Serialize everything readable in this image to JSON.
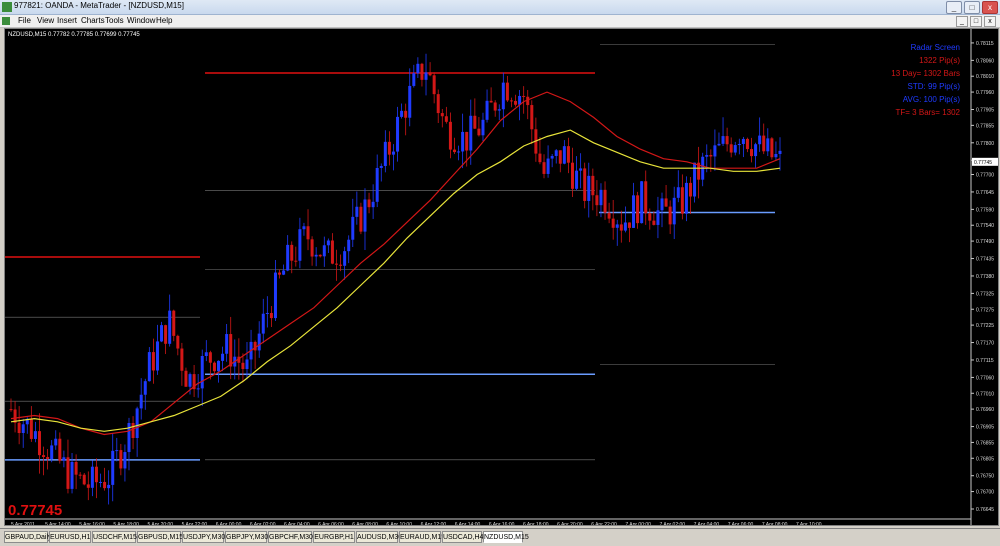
{
  "window": {
    "title": "977821: OANDA - MetaTrader - [NZDUSD,M15]",
    "buttons": [
      "_",
      "□",
      "x"
    ]
  },
  "menu": {
    "items": [
      "File",
      "View",
      "Insert",
      "Charts",
      "Tools",
      "Window",
      "Help"
    ],
    "mdi_buttons": [
      "_",
      "□",
      "x"
    ]
  },
  "chart": {
    "header": "NZDUSD,M15  0.77782 0.77785 0.77699 0.77745",
    "price_label": "0.77745",
    "current_price_box": "0.77745",
    "info": {
      "title": "Radar Screen",
      "lines": [
        "1322 Pip(s)",
        "13 Day= 1302 Bars",
        "STD: 99 Pip(s)",
        "AVG: 100 Pip(s)",
        "TF= 3 Bars= 1302"
      ]
    },
    "colors": {
      "bull": "#1f3bff",
      "bear": "#d31717",
      "ma_fast": "#d31717",
      "ma_slow": "#e8e43a",
      "level_red": "#e01010",
      "level_blue": "#6a9cff"
    }
  },
  "chart_data": {
    "type": "line",
    "symbol": "NZDUSD",
    "timeframe": "M15",
    "y_ticks": [
      0.78115,
      0.7806,
      0.7801,
      0.7796,
      0.77905,
      0.77855,
      0.778,
      0.77745,
      0.777,
      0.77645,
      0.7759,
      0.7754,
      0.7749,
      0.77435,
      0.7738,
      0.77325,
      0.77275,
      0.77225,
      0.7717,
      0.77115,
      0.7706,
      0.7701,
      0.7696,
      0.76905,
      0.76855,
      0.76805,
      0.7675,
      0.767,
      0.76645
    ],
    "ylim": [
      0.76645,
      0.7814
    ],
    "x_ticks": [
      "5 Apr 2011",
      "5 Apr 14:00",
      "5 Apr 16:00",
      "5 Apr 18:00",
      "5 Apr 20:00",
      "5 Apr 22:00",
      "6 Apr 00:00",
      "6 Apr 02:00",
      "6 Apr 04:00",
      "6 Apr 06:00",
      "6 Apr 08:00",
      "6 Apr 10:00",
      "6 Apr 12:00",
      "6 Apr 14:00",
      "6 Apr 16:00",
      "6 Apr 18:00",
      "6 Apr 20:00",
      "6 Apr 22:00",
      "7 Apr 00:00",
      "7 Apr 02:00",
      "7 Apr 04:00",
      "7 Apr 06:00",
      "7 Apr 08:00",
      "7 Apr 10:00"
    ],
    "close_path": [
      0.7696,
      0.769,
      0.7683,
      0.7675,
      0.7672,
      0.7675,
      0.7689,
      0.7709,
      0.7724,
      0.7705,
      0.7712,
      0.7715,
      0.7708,
      0.7727,
      0.7742,
      0.7751,
      0.7744,
      0.7748,
      0.776,
      0.7775,
      0.7792,
      0.7805,
      0.7785,
      0.7781,
      0.7786,
      0.7799,
      0.7795,
      0.777,
      0.7777,
      0.7765,
      0.7764,
      0.7755,
      0.7762,
      0.7757,
      0.7761,
      0.7772,
      0.7778,
      0.7784,
      0.7778,
      0.7774
    ],
    "series": [
      {
        "name": "",
        "values": [
          0.7693,
          0.7694,
          0.7693,
          0.769,
          0.7688,
          0.7689,
          0.7692,
          0.7698,
          0.7704,
          0.7708,
          0.7713,
          0.7718,
          0.7723,
          0.7728,
          0.7735,
          0.7742,
          0.7748,
          0.7755,
          0.7762,
          0.777,
          0.7778,
          0.7787,
          0.7793,
          0.7796,
          0.7793,
          0.7788,
          0.7782,
          0.7778,
          0.7775,
          0.7774,
          0.7772,
          0.7772,
          0.7772,
          0.7775
        ]
      },
      {
        "name": "",
        "values": [
          0.7692,
          0.7693,
          0.7692,
          0.769,
          0.7689,
          0.769,
          0.7692,
          0.7694,
          0.7697,
          0.77,
          0.7705,
          0.7711,
          0.7716,
          0.7722,
          0.7728,
          0.7735,
          0.7742,
          0.775,
          0.7757,
          0.7764,
          0.777,
          0.7774,
          0.7779,
          0.7782,
          0.7784,
          0.778,
          0.7777,
          0.7774,
          0.7772,
          0.7772,
          0.7772,
          0.7771,
          0.7771,
          0.7772
        ]
      }
    ],
    "levels": [
      {
        "price": 0.7802,
        "color": "red"
      },
      {
        "price": 0.7744,
        "color": "red"
      },
      {
        "price": 0.7758,
        "color": "blue"
      },
      {
        "price": 0.7707,
        "color": "blue"
      },
      {
        "price": 0.768,
        "color": "blue"
      }
    ]
  },
  "tabs": [
    "GBPAUD,Daily",
    "EURUSD,H1",
    "USDCHF,M15",
    "GBPUSD,M15",
    "USDJPY,M30",
    "GBPJPY,M30",
    "GBPCHF,M30",
    "EURGBP,H1",
    "AUDUSD,M30",
    "EURAUD,M15",
    "USDCAD,H4",
    "NZDUSD,M15"
  ],
  "active_tab": "NZDUSD,M15"
}
